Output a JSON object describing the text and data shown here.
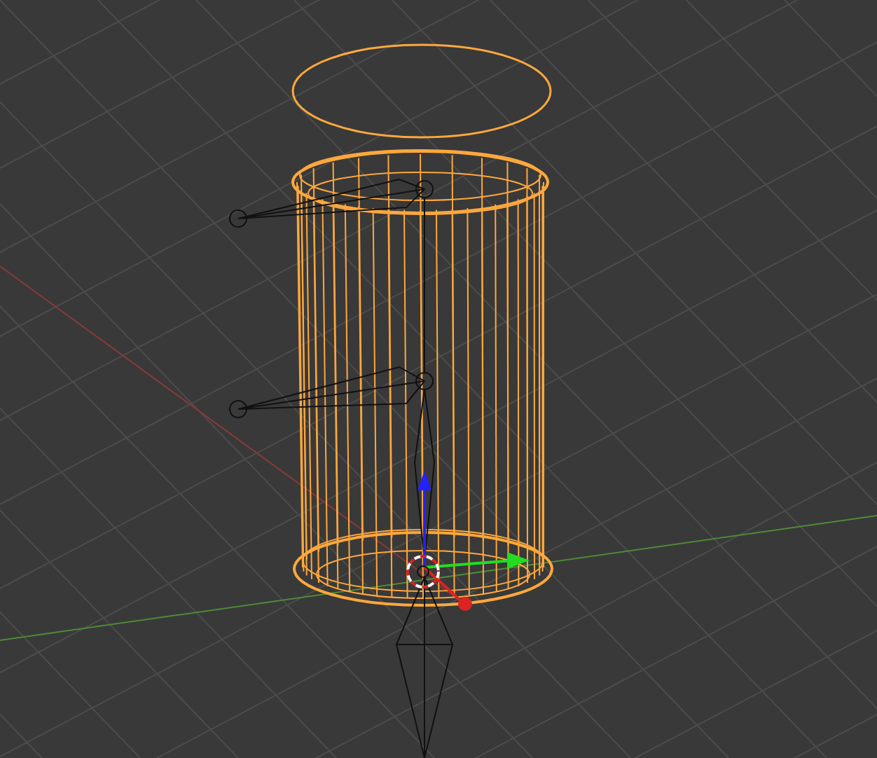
{
  "viewport": {
    "objects": [
      {
        "kind": "cylinder",
        "selected": true
      },
      {
        "kind": "circle",
        "selected": true
      },
      {
        "kind": "armature",
        "selected": false
      }
    ]
  }
}
